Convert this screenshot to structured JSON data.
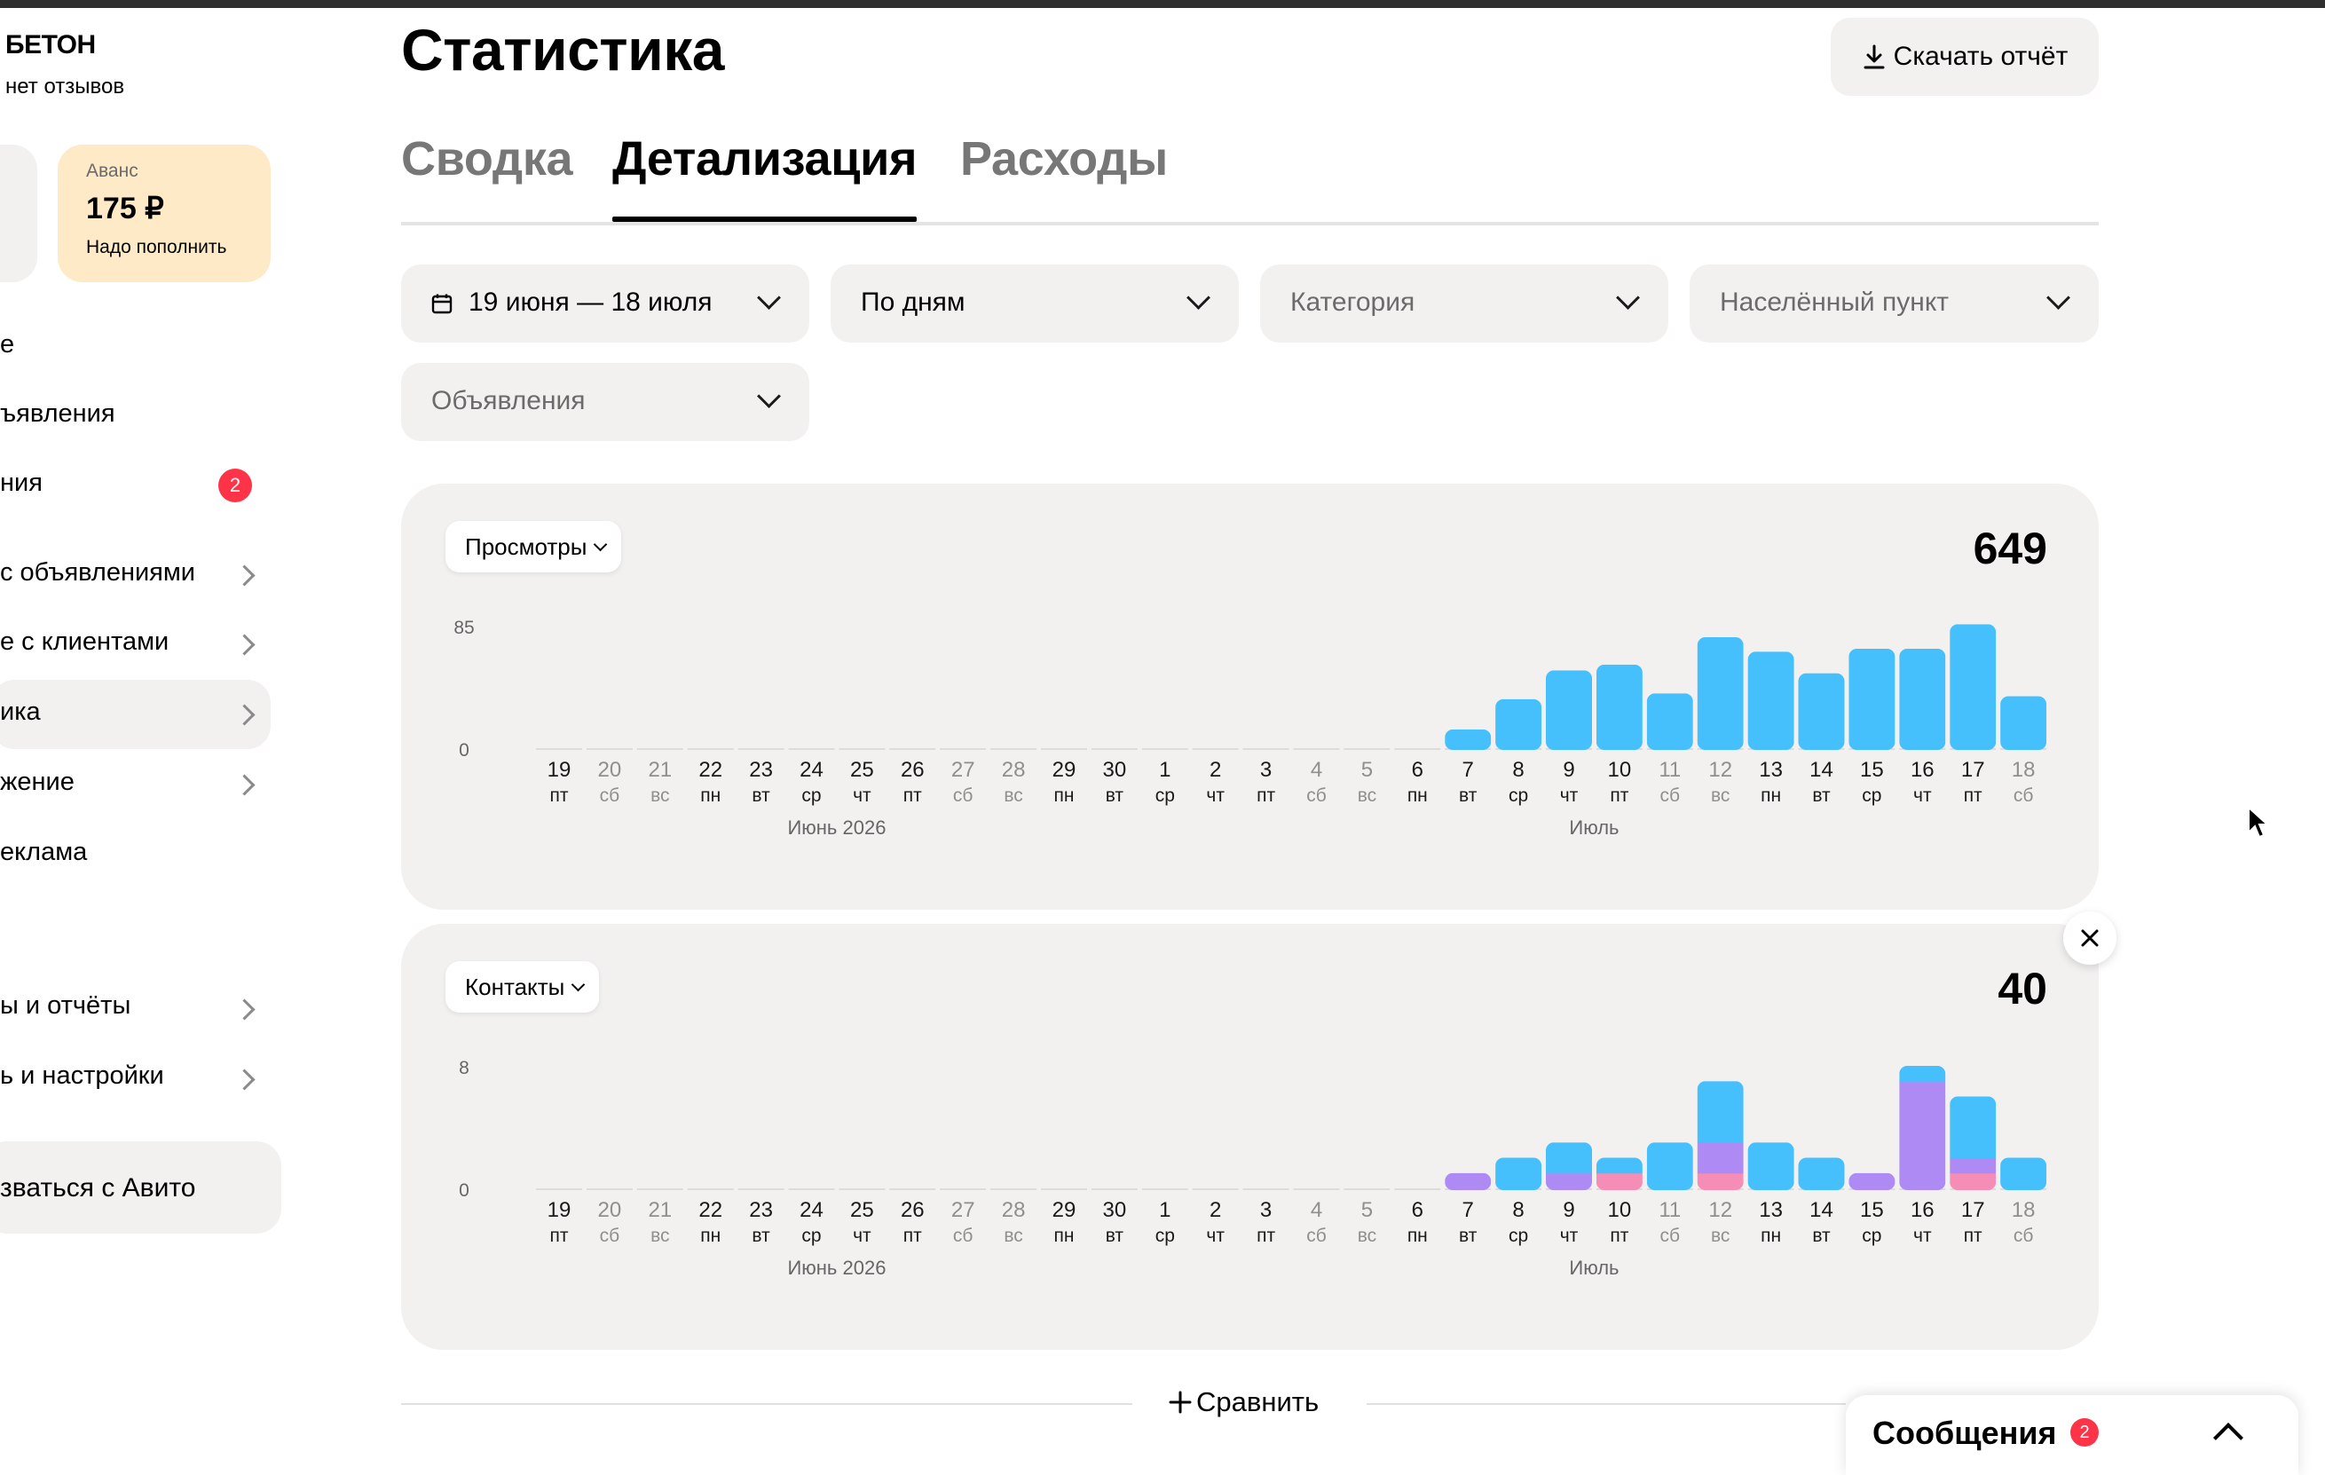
{
  "sidebar": {
    "shop_name": "БЕТОН",
    "reviews": "нет отзывов",
    "balance": {
      "label": "Аванс",
      "amount": "175 ₽",
      "hint": "Надо пополнить"
    },
    "items": [
      {
        "label": "е"
      },
      {
        "label": "ъявления"
      },
      {
        "label": "ния",
        "badge": "2"
      },
      {
        "label": "с объявлениями"
      },
      {
        "label": "е с клиентами"
      },
      {
        "label": "ика"
      },
      {
        "label": "жение"
      },
      {
        "label": "еклама"
      },
      {
        "label": "ы и отчёты"
      },
      {
        "label": "ь и настройки"
      }
    ],
    "bottom_button": "зваться с Авито"
  },
  "header": {
    "title": "Статистика",
    "download_label": "Скачать отчёт"
  },
  "tabs": [
    {
      "label": "Сводка",
      "active": false
    },
    {
      "label": "Детализация",
      "active": true
    },
    {
      "label": "Расходы",
      "active": false
    }
  ],
  "filters": {
    "period": "19 июня — 18 июля",
    "grouping": "По дням",
    "category_placeholder": "Категория",
    "location_placeholder": "Населённый пункт",
    "ads_placeholder": "Объявления"
  },
  "chart_data": [
    {
      "type": "bar",
      "title": "Просмотры",
      "total": "649",
      "yticks": [
        "85",
        "0"
      ],
      "ylim": [
        0,
        85
      ],
      "categories": [
        "19",
        "20",
        "21",
        "22",
        "23",
        "24",
        "25",
        "26",
        "27",
        "28",
        "29",
        "30",
        "1",
        "2",
        "3",
        "4",
        "5",
        "6",
        "7",
        "8",
        "9",
        "10",
        "11",
        "12",
        "13",
        "14",
        "15",
        "16",
        "17",
        "18"
      ],
      "weekdays": [
        "пт",
        "сб",
        "вс",
        "пн",
        "вт",
        "ср",
        "чт",
        "пт",
        "сб",
        "вс",
        "пн",
        "вт",
        "ср",
        "чт",
        "пт",
        "сб",
        "вс",
        "пн",
        "вт",
        "ср",
        "чт",
        "пт",
        "сб",
        "вс",
        "пн",
        "вт",
        "ср",
        "чт",
        "пт",
        "сб"
      ],
      "weekend": [
        false,
        true,
        true,
        false,
        false,
        false,
        false,
        false,
        true,
        true,
        false,
        false,
        false,
        false,
        false,
        true,
        true,
        false,
        false,
        false,
        false,
        false,
        true,
        true,
        false,
        false,
        false,
        false,
        false,
        true
      ],
      "month_labels": [
        "Июнь 2026",
        "Июль"
      ],
      "series": [
        {
          "color": "#45c0fc",
          "values": [
            0,
            0,
            0,
            0,
            0,
            0,
            0,
            0,
            0,
            0,
            0,
            0,
            0,
            0,
            0,
            0,
            0,
            0,
            13,
            34,
            54,
            58,
            38,
            77,
            67,
            52,
            69,
            69,
            86,
            36
          ]
        }
      ]
    },
    {
      "type": "bar",
      "stacked": true,
      "title": "Контакты",
      "total": "40",
      "yticks": [
        "8",
        "0"
      ],
      "ylim": [
        0,
        8
      ],
      "categories": [
        "19",
        "20",
        "21",
        "22",
        "23",
        "24",
        "25",
        "26",
        "27",
        "28",
        "29",
        "30",
        "1",
        "2",
        "3",
        "4",
        "5",
        "6",
        "7",
        "8",
        "9",
        "10",
        "11",
        "12",
        "13",
        "14",
        "15",
        "16",
        "17",
        "18"
      ],
      "weekdays": [
        "пт",
        "сб",
        "вс",
        "пн",
        "вт",
        "ср",
        "чт",
        "пт",
        "сб",
        "вс",
        "пн",
        "вт",
        "ср",
        "чт",
        "пт",
        "сб",
        "вс",
        "пн",
        "вт",
        "ср",
        "чт",
        "пт",
        "сб",
        "вс",
        "пн",
        "вт",
        "ср",
        "чт",
        "пт",
        "сб"
      ],
      "weekend": [
        false,
        true,
        true,
        false,
        false,
        false,
        false,
        false,
        true,
        true,
        false,
        false,
        false,
        false,
        false,
        true,
        true,
        false,
        false,
        false,
        false,
        false,
        true,
        true,
        false,
        false,
        false,
        false,
        false,
        true
      ],
      "month_labels": [
        "Июнь 2026",
        "Июль"
      ],
      "series": [
        {
          "color": "#f68db6",
          "values": [
            0,
            0,
            0,
            0,
            0,
            0,
            0,
            0,
            0,
            0,
            0,
            0,
            0,
            0,
            0,
            0,
            0,
            0,
            0,
            0,
            0,
            1,
            0,
            1,
            0,
            0,
            0,
            0,
            1,
            0
          ]
        },
        {
          "color": "#ae8af5",
          "values": [
            0,
            0,
            0,
            0,
            0,
            0,
            0,
            0,
            0,
            0,
            0,
            0,
            0,
            0,
            0,
            0,
            0,
            0,
            1,
            0,
            1,
            0,
            0,
            2,
            0,
            0,
            1,
            7,
            1,
            0
          ]
        },
        {
          "color": "#45c0fc",
          "values": [
            0,
            0,
            0,
            0,
            0,
            0,
            0,
            0,
            0,
            0,
            0,
            0,
            0,
            0,
            0,
            0,
            0,
            0,
            0,
            2,
            2,
            1,
            3,
            4,
            3,
            2,
            0,
            1,
            4,
            2
          ]
        }
      ]
    }
  ],
  "compare_label": "Сравнить",
  "messages": {
    "label": "Сообщения",
    "badge": "2"
  },
  "colors": {
    "accent_blue": "#45c0fc",
    "purple": "#ae8af5",
    "pink": "#f68db6",
    "badge_red": "#ff3347",
    "balance_bg": "#feeac6"
  }
}
